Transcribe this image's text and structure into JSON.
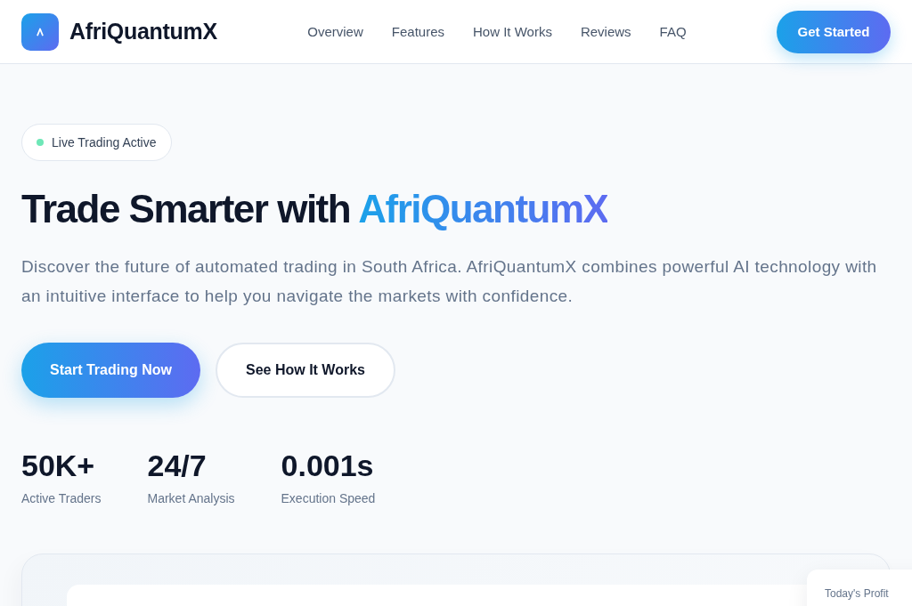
{
  "header": {
    "brand": "AfriQuantumX",
    "nav": [
      {
        "label": "Overview"
      },
      {
        "label": "Features"
      },
      {
        "label": "How It Works"
      },
      {
        "label": "Reviews"
      },
      {
        "label": "FAQ"
      }
    ],
    "cta": "Get Started"
  },
  "hero": {
    "badge": "Live Trading Active",
    "title": "Trade Smarter with",
    "title_highlight": "AfriQuantumX",
    "description": "Discover the future of automated trading in South Africa. AfriQuantumX combines powerful AI technology with an intuitive interface to help you navigate the markets with confidence.",
    "buttons": [
      {
        "label": "Start Trading Now",
        "kind": "primary"
      },
      {
        "label": "See How It Works",
        "kind": "secondary"
      }
    ],
    "stats": [
      {
        "value": "50K+",
        "label": "Active Traders"
      },
      {
        "value": "24/7",
        "label": "Market Analysis"
      },
      {
        "value": "0.001s",
        "label": "Execution Speed"
      }
    ]
  },
  "dashboard_preview": {
    "floating_card": {
      "label": "Today's Profit"
    }
  }
}
